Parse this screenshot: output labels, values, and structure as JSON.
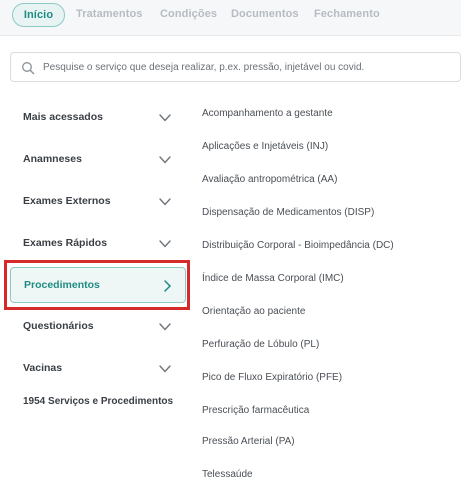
{
  "tabs": [
    "Início",
    "Tratamentos",
    "Condições",
    "Documentos",
    "Fechamento"
  ],
  "search": {
    "placeholder": "Pesquise o serviço que deseja realizar, p.ex. pressão, injetável ou covid.",
    "value": ""
  },
  "categories": {
    "mais_acessados": "Mais acessados",
    "anamneses": "Anamneses",
    "exames_externos": "Exames Externos",
    "exames_rapidos": "Exames Rápidos",
    "procedimentos": "Procedimentos",
    "questionarios": "Questionários",
    "vacinas": "Vacinas"
  },
  "selected_category": "Procedimentos",
  "count_text": "1954 Serviços e Procedimentos",
  "services": [
    "Acompanhamento a gestante",
    "Aplicações e Injetáveis (INJ)",
    "Avaliação antropométrica (AA)",
    "Dispensação de Medicamentos (DISP)",
    "Distribuição Corporal - Bioimpedância (DC)",
    "Índice de Massa Corporal (IMC)",
    "Orientação ao paciente",
    "Perfuração de Lóbulo (PL)",
    "Pico de Fluxo Expiratório (PFE)",
    "Prescrição farmacêutica",
    "Pressão Arterial (PA)",
    "Telessaúde"
  ],
  "icons": {
    "search": "search-icon",
    "expand": "chevron-down-icon",
    "open": "chevron-right-icon"
  },
  "colors": {
    "accent": "#1f8c84",
    "accent_bg": "#eef7f6",
    "highlight": "#d42a2a",
    "tab_bar": "#f6f7f8"
  }
}
